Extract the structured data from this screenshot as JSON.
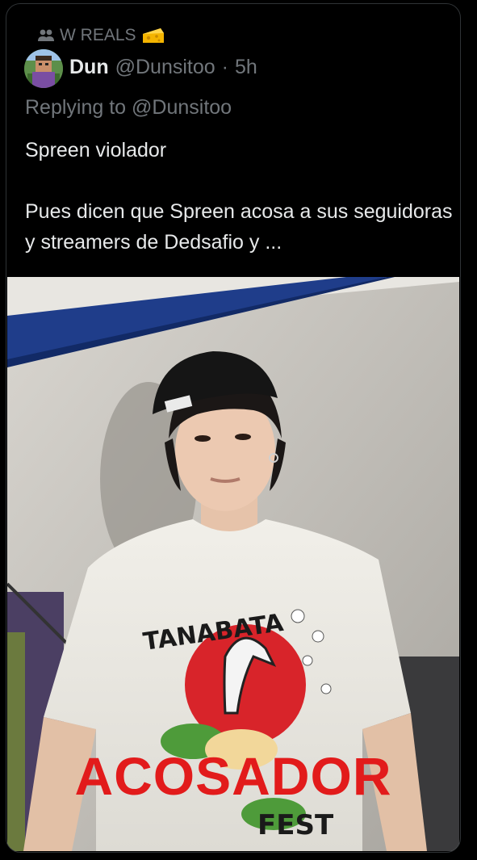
{
  "social_context": {
    "icon": "people-icon",
    "label": "W REALS",
    "emoji": "cheese-icon"
  },
  "tweet": {
    "display_name": "Dun",
    "handle": "@Dunsitoo",
    "separator": "·",
    "time": "5h",
    "replying_prefix": "Replying to",
    "replying_to": "@Dunsitoo",
    "text_line1": "Spreen violador",
    "text_line2": "Pues dicen que Spreen acosa a sus seguidoras y streamers de Dedsafio y ..."
  },
  "media": {
    "overlay_text": "ACOSADOR",
    "shirt_brand": "TANABATA",
    "shirt_bottom_text": "FEST"
  },
  "colors": {
    "background": "#000000",
    "primary_text": "#e7e9ea",
    "secondary_text": "#71767b",
    "border": "#2f3336",
    "overlay_red": "#e21b1b"
  }
}
